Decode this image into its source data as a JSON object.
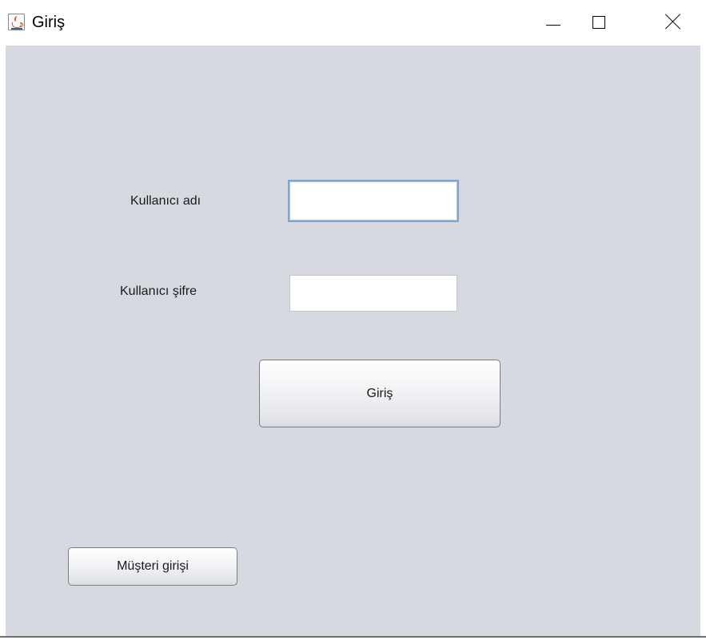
{
  "window": {
    "title": "Giriş",
    "icon": "java-cup-icon",
    "controls": {
      "minimize": "minimize-icon",
      "maximize": "maximize-icon",
      "close": "close-icon"
    }
  },
  "form": {
    "username_label": "Kullanıcı adı",
    "username_value": "",
    "password_label": "Kullanıcı şifre",
    "password_value": "",
    "login_button": "Giriş",
    "customer_login_button": "Müşteri girişi"
  },
  "colors": {
    "panel_background": "#d6d9e0",
    "focus_border": "#7fa6cf"
  }
}
